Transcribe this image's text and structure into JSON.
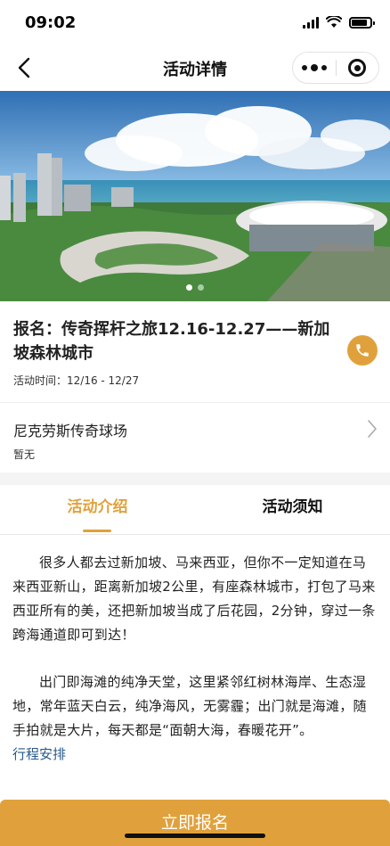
{
  "status_bar": {
    "time": "09:02"
  },
  "nav": {
    "title": "活动详情"
  },
  "banner": {
    "image_description": "",
    "dot_count": 2
  },
  "event": {
    "title": "报名：传奇挥杆之旅12.16-12.27——新加坡森林城市",
    "time": "活动时间：12/16 - 12/27"
  },
  "venue": {
    "name": "尼克劳斯传奇球场",
    "subtitle": "暂无"
  },
  "tabs": {
    "intro": "活动介绍",
    "notice": "活动须知"
  },
  "content": {
    "paragraphs": [
      "很多人都去过新加坡、马来西亚，但你不一定知道在马来西亚新山，距离新加坡2公里，有座森林城市，打包了马来西亚所有的美，还把新加坡当成了后花园，2分钟，穿过一条跨海通道即可到达！",
      "出门即海滩的纯净天堂，这里紧邻红树林海岸、生态湿地，常年蓝天白云，纯净海风，无雾霾；出门就是海滩，随手拍就是大片，每天都是“面朝大海，春暖花开”。"
    ],
    "schedule_link": "行程安排"
  },
  "signup": {
    "label": "立即报名"
  },
  "colors": {
    "accent": "#E0A13C",
    "link": "#2a5a8a"
  }
}
